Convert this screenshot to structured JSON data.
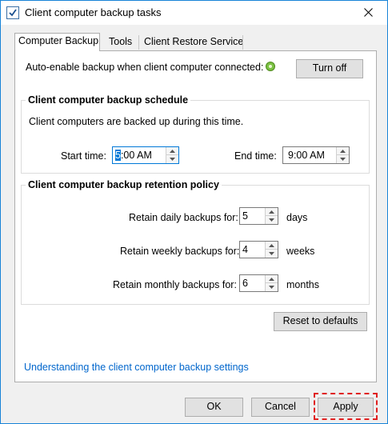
{
  "window": {
    "title": "Client computer backup tasks",
    "accent_color": "#1883d7",
    "icons": {
      "app": "checkbox-app-icon",
      "close": "close-icon"
    }
  },
  "tabs": [
    {
      "label": "Computer Backup",
      "active": true
    },
    {
      "label": "Tools",
      "active": false
    },
    {
      "label": "Client Restore Service",
      "active": false
    }
  ],
  "auto_enable": {
    "label": "Auto-enable backup when client computer connected:",
    "status_color": "#7ac142",
    "button_label": "Turn off"
  },
  "schedule": {
    "title": "Client computer backup schedule",
    "description": "Client computers are backed up during this time.",
    "start_label": "Start time:",
    "start_selected": "5",
    "start_rest": ":00 AM",
    "end_label": "End time:",
    "end_value": "9:00 AM"
  },
  "retention": {
    "title": "Client computer backup retention policy",
    "rows": [
      {
        "label": "Retain daily backups for:",
        "value": "5",
        "unit": "days"
      },
      {
        "label": "Retain weekly backups for:",
        "value": "4",
        "unit": "weeks"
      },
      {
        "label": "Retain monthly backups for:",
        "value": "6",
        "unit": "months"
      }
    ]
  },
  "reset_label": "Reset to defaults",
  "help_link": "Understanding the client computer backup settings",
  "footer": {
    "ok_label": "OK",
    "cancel_label": "Cancel",
    "apply_label": "Apply",
    "highlight_color": "#e02020"
  }
}
